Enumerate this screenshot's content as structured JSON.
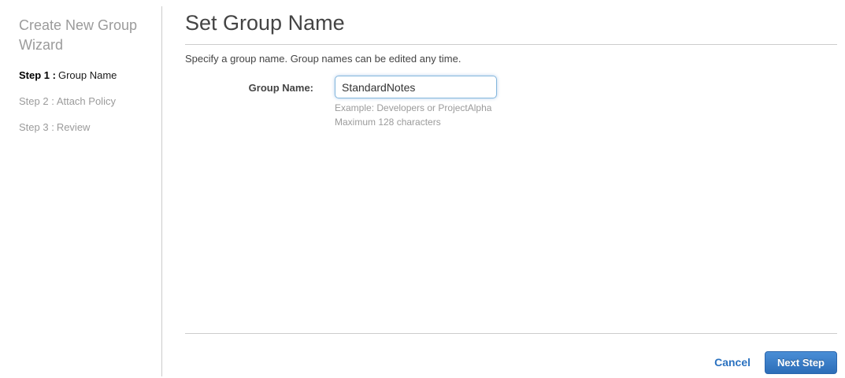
{
  "sidebar": {
    "title": "Create New Group Wizard",
    "steps": [
      {
        "prefix": "Step 1 :",
        "label": "Group Name",
        "active": true
      },
      {
        "prefix": "Step 2 :",
        "label": "Attach Policy",
        "active": false
      },
      {
        "prefix": "Step 3 :",
        "label": "Review",
        "active": false
      }
    ]
  },
  "main": {
    "title": "Set Group Name",
    "description": "Specify a group name. Group names can be edited any time.",
    "form": {
      "label": "Group Name:",
      "value": "StandardNotes",
      "help_line1": "Example: Developers or ProjectAlpha",
      "help_line2": "Maximum 128 characters"
    },
    "footer": {
      "cancel_label": "Cancel",
      "next_label": "Next Step"
    }
  },
  "colors": {
    "link_blue": "#2b72c0",
    "button_blue_top": "#4a8ed6",
    "button_blue_bottom": "#2c6db8",
    "focus_border_blue": "#85b7dd",
    "muted_gray": "#9b9b9b",
    "text_dark": "#444444",
    "divider_gray": "#cccccc"
  }
}
